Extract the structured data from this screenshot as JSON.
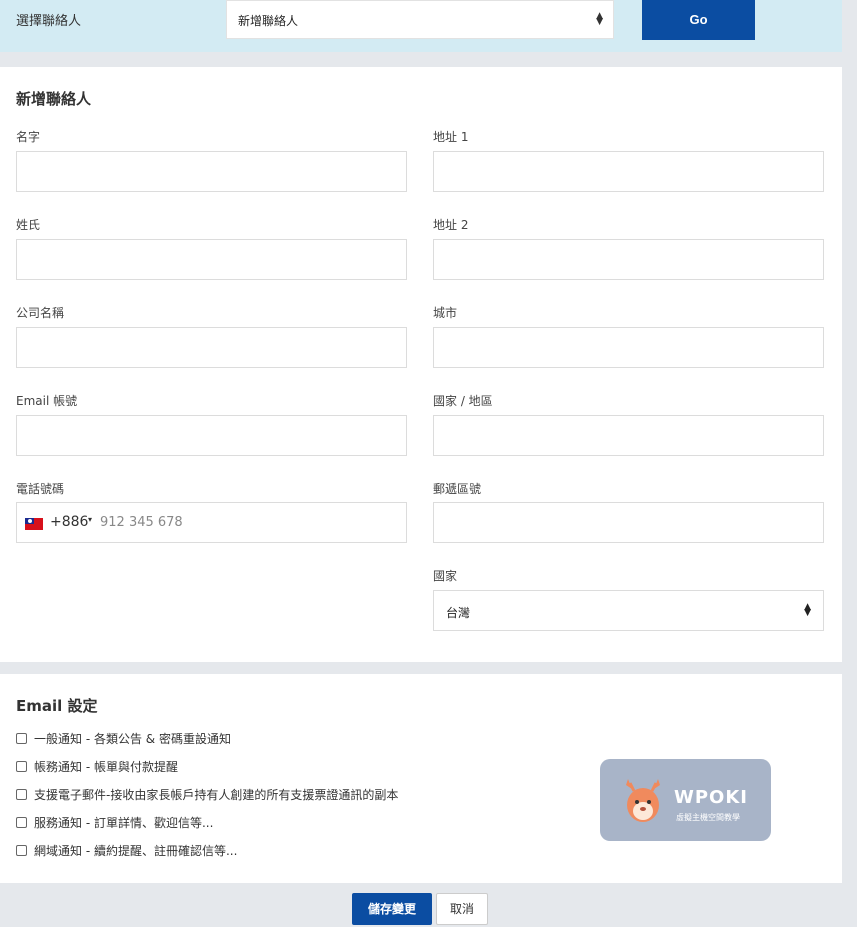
{
  "top": {
    "label": "選擇聯絡人",
    "select_value": "新增聯絡人",
    "go_label": "Go"
  },
  "form": {
    "title": "新增聯絡人",
    "left_fields": [
      {
        "label": "名字",
        "value": ""
      },
      {
        "label": "姓氏",
        "value": ""
      },
      {
        "label": "公司名稱",
        "value": ""
      },
      {
        "label": "Email 帳號",
        "value": ""
      },
      {
        "label": "電話號碼",
        "value": ""
      }
    ],
    "right_fields": [
      {
        "label": "地址 1",
        "value": ""
      },
      {
        "label": "地址 2",
        "value": ""
      },
      {
        "label": "城市",
        "value": ""
      },
      {
        "label": "國家 / 地區",
        "value": ""
      },
      {
        "label": "郵遞區號",
        "value": ""
      },
      {
        "label": "國家",
        "value": "台灣"
      }
    ],
    "phone": {
      "dial_code": "+886",
      "placeholder": "912 345 678",
      "flag_icon": "taiwan-flag-icon"
    }
  },
  "email_settings": {
    "title": "Email 設定",
    "options": [
      {
        "label": "一般通知 - 各類公告 & 密碼重設通知",
        "checked": false
      },
      {
        "label": "帳務通知 - 帳單與付款提醒",
        "checked": false
      },
      {
        "label": "支援電子郵件-接收由家長帳戶持有人創建的所有支援票證通訊的副本",
        "checked": false
      },
      {
        "label": "服務通知 - 訂單詳情、歡迎信等...",
        "checked": false
      },
      {
        "label": "網域通知 - 續約提醒、註冊確認信等...",
        "checked": false
      }
    ]
  },
  "watermark": {
    "brand": "WPOKI",
    "subtitle": "虛擬主機空間教學"
  },
  "actions": {
    "save_label": "儲存變更",
    "cancel_label": "取消"
  },
  "colors": {
    "primary": "#0b4da2",
    "top_bar_bg": "#d3ebf3",
    "page_bg": "#e5e8ec"
  }
}
